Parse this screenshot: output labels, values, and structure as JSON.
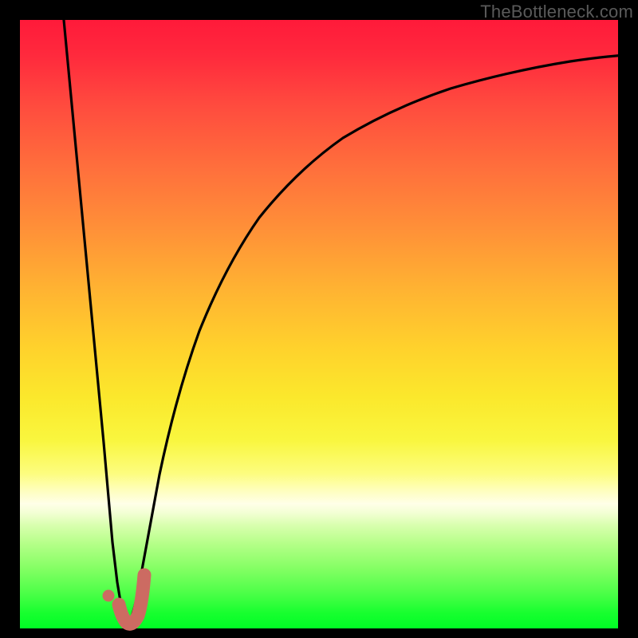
{
  "watermark": "TheBottleneck.com",
  "colors": {
    "curve": "#000000",
    "accent": "#cc6b62",
    "background_black": "#000000"
  },
  "chart_data": {
    "type": "line",
    "title": "",
    "xlabel": "",
    "ylabel": "",
    "xlim": [
      0,
      100
    ],
    "ylim": [
      0,
      100
    ],
    "grid": false,
    "legend": false,
    "series": [
      {
        "name": "bottleneck-curve",
        "x": [
          7.3,
          10,
          12,
          14,
          15.5,
          17,
          18.5,
          20,
          22,
          25,
          29,
          34,
          40,
          48,
          58,
          70,
          85,
          100
        ],
        "y": [
          100,
          60,
          30,
          10,
          2,
          0.5,
          2,
          8,
          22,
          42,
          59,
          71,
          79.5,
          85.5,
          89.5,
          92,
          93.5,
          94.2
        ],
        "note": "y is bottleneck percentage from bottom (0) to top (100). Minimum at x≈17."
      }
    ],
    "marker": {
      "name": "recommended-point",
      "x": 15.6,
      "y": 5.5,
      "comment": "small pink dot; a short pink J-stroke spans roughly x 16.5–20 near the curve bottom"
    },
    "accent_stroke": {
      "name": "j-stroke",
      "x": [
        16.6,
        17.1,
        17.9,
        18.8,
        19.6,
        20.1
      ],
      "y": [
        4.0,
        1.8,
        0.9,
        2.1,
        5.2,
        8.8
      ]
    }
  }
}
